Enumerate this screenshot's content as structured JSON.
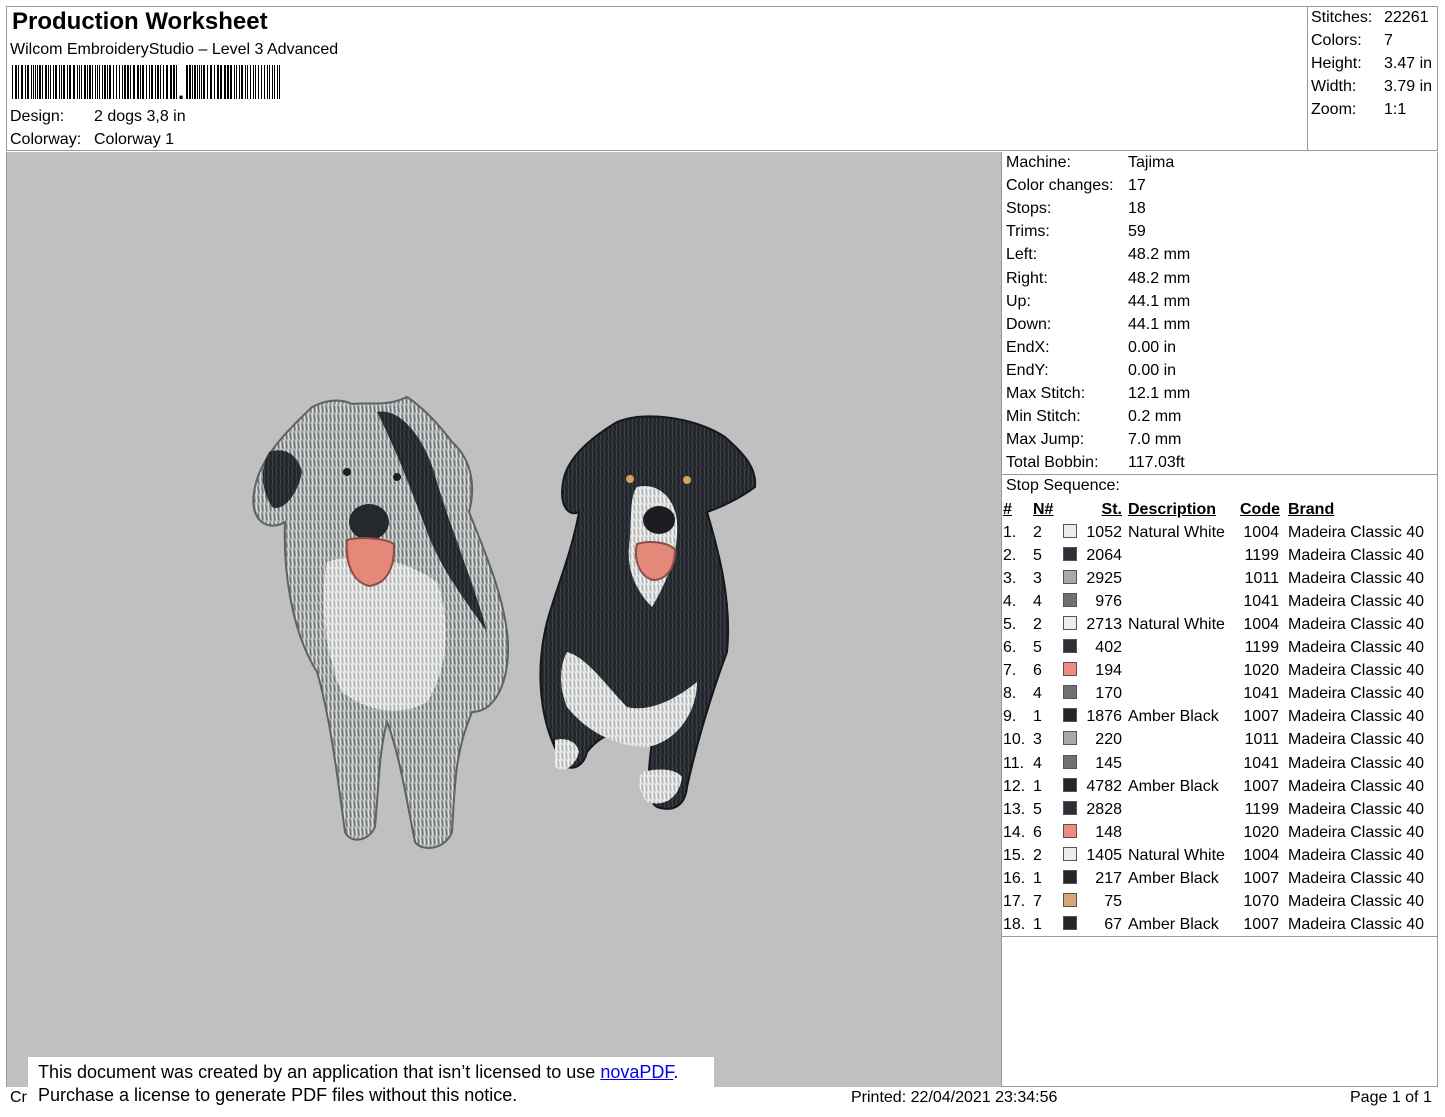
{
  "header": {
    "title": "Production Worksheet",
    "software": "Wilcom EmbroideryStudio – Level 3 Advanced",
    "design_label": "Design:",
    "design_value": "2 dogs 3,8 in",
    "colorway_label": "Colorway:",
    "colorway_value": "Colorway 1"
  },
  "summary": [
    {
      "label": "Stitches:",
      "value": "22261"
    },
    {
      "label": "Colors:",
      "value": "7"
    },
    {
      "label": "Height:",
      "value": "3.47 in"
    },
    {
      "label": "Width:",
      "value": "3.79 in"
    },
    {
      "label": "Zoom:",
      "value": "1:1"
    }
  ],
  "machine_info": [
    {
      "label": "Machine:",
      "value": "Tajima"
    },
    {
      "label": "Color changes:",
      "value": "17"
    },
    {
      "label": "Stops:",
      "value": "18"
    },
    {
      "label": "Trims:",
      "value": "59"
    },
    {
      "label": "Left:",
      "value": "48.2 mm"
    },
    {
      "label": "Right:",
      "value": "48.2 mm"
    },
    {
      "label": "Up:",
      "value": "44.1 mm"
    },
    {
      "label": "Down:",
      "value": "44.1 mm"
    },
    {
      "label": "EndX:",
      "value": "0.00 in"
    },
    {
      "label": "EndY:",
      "value": "0.00 in"
    },
    {
      "label": "Max Stitch:",
      "value": "12.1 mm"
    },
    {
      "label": "Min Stitch:",
      "value": "0.2 mm"
    },
    {
      "label": "Max Jump:",
      "value": "7.0 mm"
    },
    {
      "label": "Total Bobbin:",
      "value": "117.03ft"
    }
  ],
  "stop_sequence": {
    "title": "Stop Sequence:",
    "headers": [
      "#",
      "N#",
      "St.",
      "Description",
      "Code",
      "Brand"
    ],
    "rows": [
      {
        "n": "1.",
        "needle": "2",
        "color": "#ececec",
        "st": "1052",
        "desc": "Natural White",
        "code": "1004",
        "brand": "Madeira Classic 40"
      },
      {
        "n": "2.",
        "needle": "5",
        "color": "#2b2f36",
        "st": "2064",
        "desc": "",
        "code": "1199",
        "brand": "Madeira Classic 40"
      },
      {
        "n": "3.",
        "needle": "3",
        "color": "#a9aaa8",
        "st": "2925",
        "desc": "",
        "code": "1011",
        "brand": "Madeira Classic 40"
      },
      {
        "n": "4.",
        "needle": "4",
        "color": "#6d7075",
        "st": "976",
        "desc": "",
        "code": "1041",
        "brand": "Madeira Classic 40"
      },
      {
        "n": "5.",
        "needle": "2",
        "color": "#ececec",
        "st": "2713",
        "desc": "Natural White",
        "code": "1004",
        "brand": "Madeira Classic 40"
      },
      {
        "n": "6.",
        "needle": "5",
        "color": "#2b2f36",
        "st": "402",
        "desc": "",
        "code": "1199",
        "brand": "Madeira Classic 40"
      },
      {
        "n": "7.",
        "needle": "6",
        "color": "#f08a7e",
        "st": "194",
        "desc": "",
        "code": "1020",
        "brand": "Madeira Classic 40"
      },
      {
        "n": "8.",
        "needle": "4",
        "color": "#6d7075",
        "st": "170",
        "desc": "",
        "code": "1041",
        "brand": "Madeira Classic 40"
      },
      {
        "n": "9.",
        "needle": "1",
        "color": "#252525",
        "st": "1876",
        "desc": "Amber Black",
        "code": "1007",
        "brand": "Madeira Classic 40"
      },
      {
        "n": "10.",
        "needle": "3",
        "color": "#a9aaa8",
        "st": "220",
        "desc": "",
        "code": "1011",
        "brand": "Madeira Classic 40"
      },
      {
        "n": "11.",
        "needle": "4",
        "color": "#6d7075",
        "st": "145",
        "desc": "",
        "code": "1041",
        "brand": "Madeira Classic 40"
      },
      {
        "n": "12.",
        "needle": "1",
        "color": "#252525",
        "st": "4782",
        "desc": "Amber Black",
        "code": "1007",
        "brand": "Madeira Classic 40"
      },
      {
        "n": "13.",
        "needle": "5",
        "color": "#2b2f36",
        "st": "2828",
        "desc": "",
        "code": "1199",
        "brand": "Madeira Classic 40"
      },
      {
        "n": "14.",
        "needle": "6",
        "color": "#f08a7e",
        "st": "148",
        "desc": "",
        "code": "1020",
        "brand": "Madeira Classic 40"
      },
      {
        "n": "15.",
        "needle": "2",
        "color": "#ececec",
        "st": "1405",
        "desc": "Natural White",
        "code": "1004",
        "brand": "Madeira Classic 40"
      },
      {
        "n": "16.",
        "needle": "1",
        "color": "#252525",
        "st": "217",
        "desc": "Amber Black",
        "code": "1007",
        "brand": "Madeira Classic 40"
      },
      {
        "n": "17.",
        "needle": "7",
        "color": "#d4a872",
        "st": "75",
        "desc": "",
        "code": "1070",
        "brand": "Madeira Classic 40"
      },
      {
        "n": "18.",
        "needle": "1",
        "color": "#252525",
        "st": "67",
        "desc": "Amber Black",
        "code": "1007",
        "brand": "Madeira Classic 40"
      }
    ]
  },
  "footer": {
    "left_fragment": "Cr",
    "printed": "Printed: 22/04/2021 23:34:56",
    "page": "Page 1 of 1"
  },
  "notice": {
    "line1_prefix": "This document was created by an application that isn’t licensed to use ",
    "link": "novaPDF",
    "line1_suffix": ".",
    "line2": "Purchase a license to generate PDF files without this notice."
  },
  "colors": {
    "preview_background": "#c0c0c0",
    "frame": "#999999"
  }
}
